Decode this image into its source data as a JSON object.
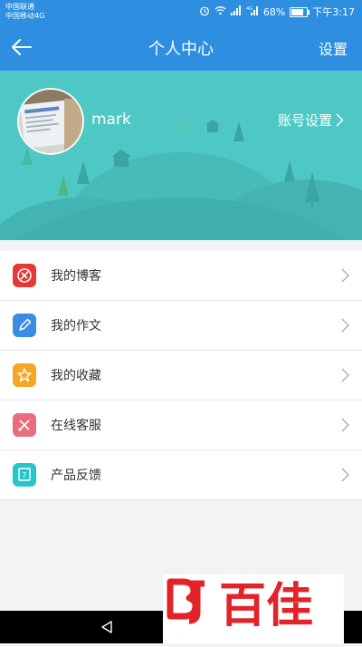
{
  "status_bar": {
    "carrier1": "中国联通",
    "carrier2": "中国移动4G",
    "battery": "68%",
    "time": "下午3:17"
  },
  "title_bar": {
    "title": "个人中心",
    "settings_label": "设置"
  },
  "profile": {
    "username": "mark",
    "account_settings_label": "账号设置"
  },
  "menu": {
    "items": [
      {
        "label": "我的博客",
        "color": "#e53935"
      },
      {
        "label": "我的作文",
        "color": "#3b8de3"
      },
      {
        "label": "我的收藏",
        "color": "#f5a623"
      },
      {
        "label": "在线客服",
        "color": "#e86d7f"
      },
      {
        "label": "产品反馈",
        "color": "#26c6c6"
      }
    ]
  },
  "watermark": {
    "text": "百佳"
  },
  "colors": {
    "primary": "#2e8fe0",
    "banner": "#4ec8c5",
    "watermark_red": "#e2232a"
  }
}
